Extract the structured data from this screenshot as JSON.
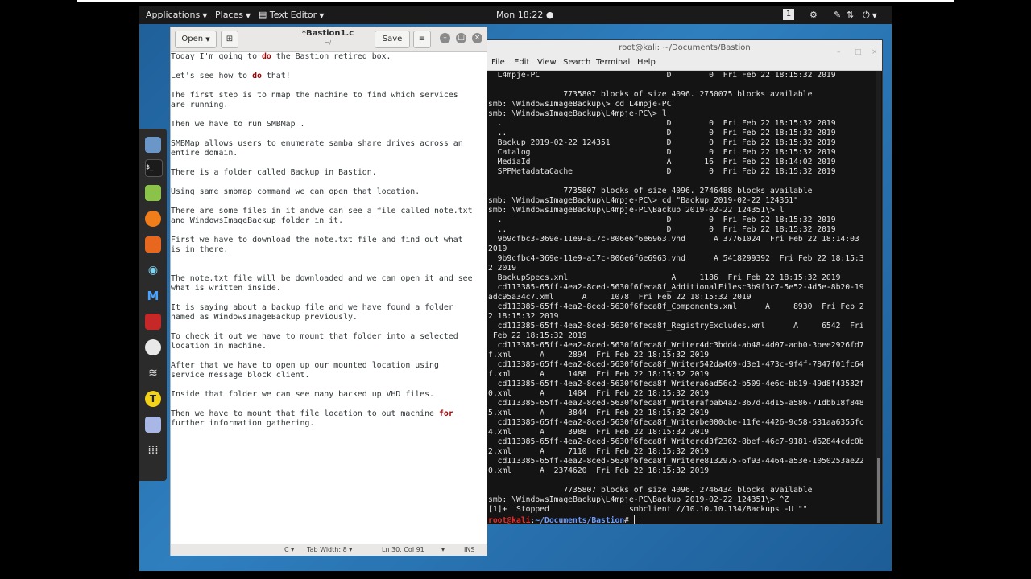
{
  "top_panel": {
    "applications": "Applications",
    "places": "Places",
    "text_editor": "Text Editor",
    "clock": "Mon 18:22",
    "workspace": "1"
  },
  "gedit": {
    "open_label": "Open",
    "title": "*Bastion1.c",
    "subtitle": "~/",
    "save_label": "Save",
    "lines": [
      [
        [
          "Today I'm going to ",
          ""
        ],
        [
          "do",
          "kw"
        ],
        [
          " the Bastion retired box.",
          ""
        ]
      ],
      [
        [
          "",
          ""
        ]
      ],
      [
        [
          "Let's see how to ",
          ""
        ],
        [
          "do",
          "kw"
        ],
        [
          " that!",
          ""
        ]
      ],
      [
        [
          "",
          ""
        ]
      ],
      [
        [
          "The first step is to nmap the machine to find which services",
          ""
        ]
      ],
      [
        [
          "are running.",
          ""
        ]
      ],
      [
        [
          "",
          ""
        ]
      ],
      [
        [
          "Then we have to run SMBMap .",
          ""
        ]
      ],
      [
        [
          "",
          ""
        ]
      ],
      [
        [
          "SMBMap allows users to enumerate samba share drives across an",
          ""
        ]
      ],
      [
        [
          "entire domain.",
          ""
        ]
      ],
      [
        [
          "",
          ""
        ]
      ],
      [
        [
          "There is a folder called Backup in Bastion.",
          ""
        ]
      ],
      [
        [
          "",
          ""
        ]
      ],
      [
        [
          "Using same smbmap command we can open that location.",
          ""
        ]
      ],
      [
        [
          "",
          ""
        ]
      ],
      [
        [
          "There are some files in it andwe can see a file called note.txt",
          ""
        ]
      ],
      [
        [
          "and WindowsImageBackup folder in it.",
          ""
        ]
      ],
      [
        [
          "",
          ""
        ]
      ],
      [
        [
          "First we have to download the note.txt file and find out what",
          ""
        ]
      ],
      [
        [
          "is in there.",
          ""
        ]
      ],
      [
        [
          "",
          ""
        ]
      ],
      [
        [
          "",
          ""
        ]
      ],
      [
        [
          "The note.txt file will be downloaded and we can open it and see",
          ""
        ]
      ],
      [
        [
          "what is written inside.",
          ""
        ]
      ],
      [
        [
          "",
          ""
        ]
      ],
      [
        [
          "It is saying about a backup file and we have found a folder",
          ""
        ]
      ],
      [
        [
          "named as WindowsImageBackup previously.",
          ""
        ]
      ],
      [
        [
          "",
          ""
        ]
      ],
      [
        [
          "To check it out we have to mount that folder into a selected",
          ""
        ]
      ],
      [
        [
          "location in machine.",
          ""
        ]
      ],
      [
        [
          "",
          ""
        ]
      ],
      [
        [
          "After that we have to open up our mounted location using",
          ""
        ]
      ],
      [
        [
          "service message block client.",
          ""
        ]
      ],
      [
        [
          "",
          ""
        ]
      ],
      [
        [
          "Inside that folder we can see many backed up VHD files.",
          ""
        ]
      ],
      [
        [
          "",
          ""
        ]
      ],
      [
        [
          "Then we have to mount that file location to out machine ",
          ""
        ],
        [
          "for",
          "kw"
        ]
      ],
      [
        [
          "further information gathering.",
          ""
        ]
      ]
    ],
    "status": {
      "language": "C",
      "tab_width": "Tab Width: 8",
      "position": "Ln 30, Col 91",
      "mode": "INS"
    }
  },
  "terminal": {
    "title": "root@kali: ~/Documents/Bastion",
    "menu": [
      "File",
      "Edit",
      "View",
      "Search",
      "Terminal",
      "Help"
    ],
    "lines": [
      "  L4mpje-PC                           D        0  Fri Feb 22 18:15:32 2019",
      "",
      "                7735807 blocks of size 4096. 2750075 blocks available",
      "smb: \\WindowsImageBackup\\> cd L4mpje-PC",
      "smb: \\WindowsImageBackup\\L4mpje-PC\\> l",
      "  .                                   D        0  Fri Feb 22 18:15:32 2019",
      "  ..                                  D        0  Fri Feb 22 18:15:32 2019",
      "  Backup 2019-02-22 124351            D        0  Fri Feb 22 18:15:32 2019",
      "  Catalog                             D        0  Fri Feb 22 18:15:32 2019",
      "  MediaId                             A       16  Fri Feb 22 18:14:02 2019",
      "  SPPMetadataCache                    D        0  Fri Feb 22 18:15:32 2019",
      "",
      "                7735807 blocks of size 4096. 2746488 blocks available",
      "smb: \\WindowsImageBackup\\L4mpje-PC\\> cd \"Backup 2019-02-22 124351\"",
      "smb: \\WindowsImageBackup\\L4mpje-PC\\Backup 2019-02-22 124351\\> l",
      "  .                                   D        0  Fri Feb 22 18:15:32 2019",
      "  ..                                  D        0  Fri Feb 22 18:15:32 2019",
      "  9b9cfbc3-369e-11e9-a17c-806e6f6e6963.vhd      A 37761024  Fri Feb 22 18:14:03",
      "2019",
      "  9b9cfbc4-369e-11e9-a17c-806e6f6e6963.vhd      A 5418299392  Fri Feb 22 18:15:3",
      "2 2019",
      "  BackupSpecs.xml                      A     1186  Fri Feb 22 18:15:32 2019",
      "  cd113385-65ff-4ea2-8ced-5630f6feca8f_AdditionalFilesc3b9f3c7-5e52-4d5e-8b20-19",
      "adc95a34c7.xml      A     1078  Fri Feb 22 18:15:32 2019",
      "  cd113385-65ff-4ea2-8ced-5630f6feca8f_Components.xml      A     8930  Fri Feb 2",
      "2 18:15:32 2019",
      "  cd113385-65ff-4ea2-8ced-5630f6feca8f_RegistryExcludes.xml      A     6542  Fri",
      " Feb 22 18:15:32 2019",
      "  cd113385-65ff-4ea2-8ced-5630f6feca8f_Writer4dc3bdd4-ab48-4d07-adb0-3bee2926fd7",
      "f.xml      A     2894  Fri Feb 22 18:15:32 2019",
      "  cd113385-65ff-4ea2-8ced-5630f6feca8f_Writer542da469-d3e1-473c-9f4f-7847f01fc64",
      "f.xml      A     1488  Fri Feb 22 18:15:32 2019",
      "  cd113385-65ff-4ea2-8ced-5630f6feca8f_Writera6ad56c2-b509-4e6c-bb19-49d8f43532f",
      "0.xml      A     1484  Fri Feb 22 18:15:32 2019",
      "  cd113385-65ff-4ea2-8ced-5630f6feca8f_Writerafbab4a2-367d-4d15-a586-71dbb18f848",
      "5.xml      A     3844  Fri Feb 22 18:15:32 2019",
      "  cd113385-65ff-4ea2-8ced-5630f6feca8f_Writerbe000cbe-11fe-4426-9c58-531aa6355fc",
      "4.xml      A     3988  Fri Feb 22 18:15:32 2019",
      "  cd113385-65ff-4ea2-8ced-5630f6feca8f_Writercd3f2362-8bef-46c7-9181-d62844cdc0b",
      "2.xml      A     7110  Fri Feb 22 18:15:32 2019",
      "  cd113385-65ff-4ea2-8ced-5630f6feca8f_Writere8132975-6f93-4464-a53e-1050253ae22",
      "0.xml      A  2374620  Fri Feb 22 18:15:32 2019",
      "",
      "                7735807 blocks of size 4096. 2746434 blocks available",
      "smb: \\WindowsImageBackup\\L4mpje-PC\\Backup 2019-02-22 124351\\> ^Z",
      "[1]+  Stopped                 smbclient //10.10.10.134/Backups -U \"\""
    ],
    "prompt_user": "root@kali",
    "prompt_sep": ":",
    "prompt_path": "~/Documents/Bastion",
    "prompt_end": "# "
  },
  "dock_icons": [
    "files-icon",
    "terminal-icon",
    "notes-icon",
    "firefox-icon",
    "burpsuite-icon",
    "maltego-icon",
    "metasploit-icon",
    "cherrytree-icon",
    "faraday-icon",
    "wifi-icon",
    "tool-icon",
    "text-editor-icon",
    "show-apps-icon"
  ]
}
